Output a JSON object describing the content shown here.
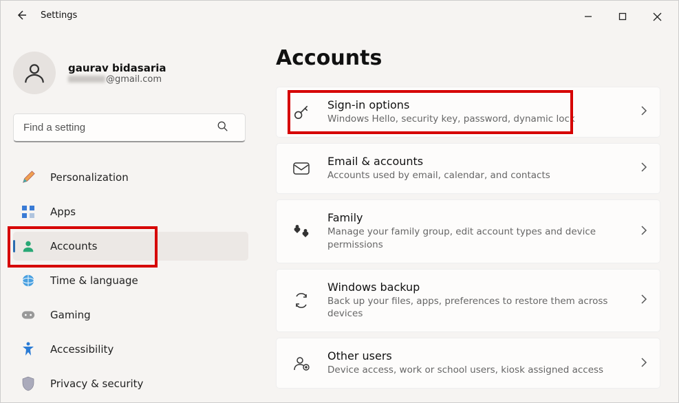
{
  "window": {
    "title": "Settings"
  },
  "profile": {
    "name": "gaurav bidasaria",
    "email_suffix": "@gmail.com"
  },
  "search": {
    "placeholder": "Find a setting"
  },
  "sidebar": {
    "items": [
      {
        "label": "Personalization"
      },
      {
        "label": "Apps"
      },
      {
        "label": "Accounts"
      },
      {
        "label": "Time & language"
      },
      {
        "label": "Gaming"
      },
      {
        "label": "Accessibility"
      },
      {
        "label": "Privacy & security"
      }
    ]
  },
  "page": {
    "title": "Accounts"
  },
  "cards": [
    {
      "title": "Sign-in options",
      "desc": "Windows Hello, security key, password, dynamic lock"
    },
    {
      "title": "Email & accounts",
      "desc": "Accounts used by email, calendar, and contacts"
    },
    {
      "title": "Family",
      "desc": "Manage your family group, edit account types and device permissions"
    },
    {
      "title": "Windows backup",
      "desc": "Back up your files, apps, preferences to restore them across devices"
    },
    {
      "title": "Other users",
      "desc": "Device access, work or school users, kiosk assigned access"
    }
  ]
}
